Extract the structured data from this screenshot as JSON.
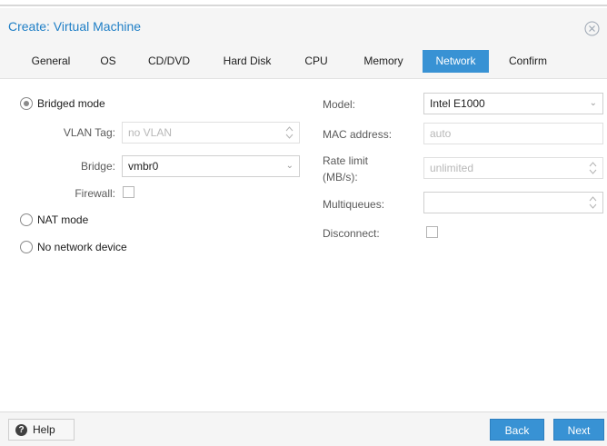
{
  "window": {
    "title": "Create: Virtual Machine"
  },
  "tabs": [
    {
      "label": "General"
    },
    {
      "label": "OS"
    },
    {
      "label": "CD/DVD"
    },
    {
      "label": "Hard Disk"
    },
    {
      "label": "CPU"
    },
    {
      "label": "Memory"
    },
    {
      "label": "Network",
      "active": true
    },
    {
      "label": "Confirm"
    }
  ],
  "left": {
    "bridged_label": "Bridged mode",
    "vlan_label": "VLAN Tag:",
    "vlan_placeholder": "no VLAN",
    "bridge_label": "Bridge:",
    "bridge_value": "vmbr0",
    "firewall_label": "Firewall:",
    "nat_label": "NAT mode",
    "none_label": "No network device",
    "selected_mode": "Bridged mode"
  },
  "right": {
    "model_label": "Model:",
    "model_value": "Intel E1000",
    "mac_label": "MAC address:",
    "mac_placeholder": "auto",
    "rate_label_1": "Rate limit",
    "rate_label_2": "(MB/s):",
    "rate_placeholder": "unlimited",
    "multiqueues_label": "Multiqueues:",
    "multiqueues_value": "",
    "disconnect_label": "Disconnect:"
  },
  "footer": {
    "help_label": "Help",
    "back_label": "Back",
    "next_label": "Next"
  },
  "colors": {
    "accent": "#3892d4",
    "title": "#1f7fc6"
  },
  "icons": [
    "close-icon",
    "help-icon",
    "chevron-down-icon",
    "spinner-icon"
  ]
}
